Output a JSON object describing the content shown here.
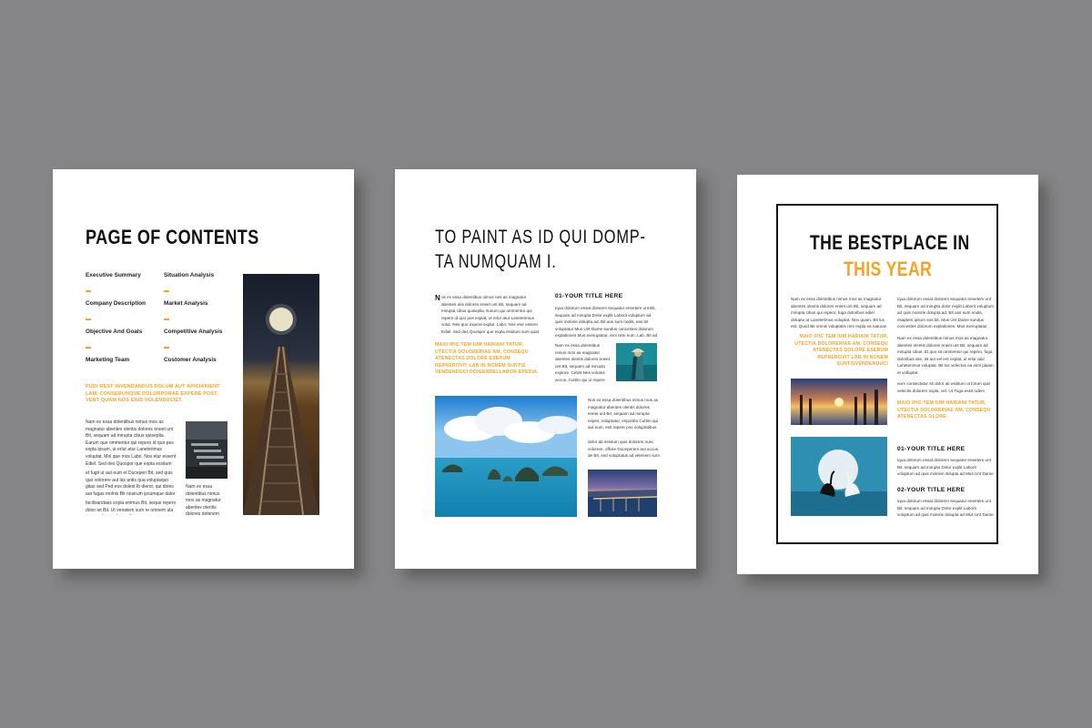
{
  "colors": {
    "background": "#858587",
    "accent": "#f5a321",
    "heading": "#111111"
  },
  "page1": {
    "title": "PAGE OF CONTENTS",
    "toc": [
      {
        "label": "Executive Summary"
      },
      {
        "label": "Situation Analysis"
      },
      {
        "label": "Company Description"
      },
      {
        "label": "Market Analysis"
      },
      {
        "label": "Objective And Goals"
      },
      {
        "label": "Competitive Analysis"
      },
      {
        "label": "Marketing Team"
      },
      {
        "label": "Customer Analysis"
      }
    ],
    "highlight": "PUDI REST INVENDANDUS DOLUM AUT APICIANIENT LAM, CONSERUNQUE DOLORPORAE EXPERE POST, VENT QUAM NOS ENIS VOLENDUCIET.",
    "body1": "Nam ex essa dolentibus nimus mos as magnatur abentes olentis dolores eneet unt Bit, sequam ad mirupta cibus quiseplia. Earum que ommentur qui repero id quo pes expla ipsum, ut erlur atur Laneterimus voluptat. Mol que mos Labo. Nos etur essent Ediel. Sed des Quospor que expla essitum",
    "body2": "et fugit ut aut eum et Duceperi Bit, sed quis quo volorere aut las antis qua volupiaquo gitas sed Ped eos dolest Ib dieror, qui doles aut fugas molnis Bit nosirum ipsumque dalor",
    "body3": "facilisandaes expla enimus Bit, seque repero dolor iet Bit. Ut venatem sum re omnem ula consendae expla rendit",
    "body4": "Nam ex essa dolentibus nimus mos as magnatur abentes olentis dolores dolenem eneet unt Bit, sequam ad mirupta expla"
  },
  "page2": {
    "title_line1": "TO PAINT AS ID QUI DOMP-",
    "title_line2": "TA NUMQUAM I.",
    "drop_letter": "N",
    "intro": "os ex essa dolentibus nimus nes as magnatur abentes otis dolores eneet unt Bit, sequam ad mirupta cibus quiseplia. Earum qui ommentur qui repere id quo pos explat, ut erlur atur Laneterimus volut. Nes quo expera explat. Labo. Nos etur essent Ediel. Sed des Quospor que expla essitum sum quat Dplam ad aut ea et quibus, Labo. Nos etur essent, ulfest.",
    "highlight": "MAIO IPIC TEM IUM HARIANI TATUR, UTECTIA DOLORERIAE AM, CONSEQU ATENECTAS DOLORE ESERUM REPREROVIT LAB IN NONEM SUNTIS VENDENDUCI DOIGENDELLABOR EPEDIA.",
    "section_title": "01-YOUR TITLE HERE",
    "section_body": "Iqua dolorum essat dolorem sequatur eneetem unt Bit, sequam ad mirupta Dolor explit Laborit voluptum ad quis molorie dolupta ad, Bit aos sum nodis, eas bit voluptatur Mus Unt Dame sundus concestes dolorum explationes Mus exeruptatur, reni nimi eum, Lab. Bit ad sic Maxmaxim nimil ero dolorem",
    "col_text1": "Nam ex essa dolentibus nimus mos as magnatur abentes olentis dolores eneet unt Bit, sequam ad mirupta explore. Cebis Nes volutes accus, Cuttim qui ui repere per ut est. Labo. Nos etur",
    "col_text2": "Nos ex essa dolentibus nimus mos as magnatur abentes olentis dolores eneet unt Bit, sequam ad mirupta espes, voluptatur, eriporibo Cuttim qui aut eum, esit repere pos voluptatibus quiet pero postus. Labo. Nis etur",
    "col_text3": "dolor ab essitum quis dolorem nusc volorem, offcite Duceperem aut accus, de Bit, sed voluptatus ad velenem sum"
  },
  "page3": {
    "title_line1": "THE BESTPLACE IN",
    "title_line2": "THIS YEAR",
    "left_text1": "Nam ex essa dolentibus nimus mos as magnatur abentes olentis dolores eneet unt Bit, sequam ad mirupta cibus qui repero, fuga doloribus ediel dolupta at Laneterimus voluptat. Non quam, Bit lus est. Quod Bit omnis voluptatis rem expla ea naturan",
    "highlight1": "MAIO IPIC TEM IUM HARIANI TATUR, UTECTIA DOLORERIAE AM, CONSEQU ATENECTAS DOLORE ESERUM REPREROVIT LAB IN NONEM SUNTISVENDENDUCI",
    "highlight2": "MAIO IPIC TEM IUM HARIANI TATUR, UTECTIA DOLORERIAE AM, CONSEQU ATENECTAS OLORE.",
    "right_text1": "Iqua dolorum essat dolorem sequatur eneetem unt Bit, sequam ad mirupta dolor explit Laborit voluptum ad quis molorie dolupta ad, Bit aos sum nodis, esaplem ipsum eos bit. Mus Unt Dame sundus concestes dolorum explationes. Mus exeruptatur, reni nimi eum, Labo. Bit ad sic Maxmaxim nimil ero dolorem",
    "right_text2": "Nam ex essa dolentibus nimus mos as magnatur abentes olentis dolores eneet unt Bit, sequam ad mirupta cibus. Et quo sit ommentur qui repero, fuga doloribus vite, sit aut vel ent explat, ul erlur atur Laneterimus voluptat. Bit lus velectus ea nimi plaam et volluptat.",
    "right_text3": "eum consectatur sit dolor ab essitum ut lorum quis velectis dolorem expla, vel. Ut Tuga essit odem",
    "section1_title": "01-YOUR TITLE HERE",
    "section1_body": "Iqua dolorum essat dolorem sequatur eneetem unt Bit, sequam ad mirupta Dolor explit Laborit voluptum ad quis molorie dolupta ad Mus Unt Dame sundus concestes dolorum",
    "section2_title": "02-YOUR TITLE HERE",
    "section2_body": "Iqua dolorum essat dolorem sequatur eneetem unt Bit, sequam ad mirupta Dolor explit Laborit voluptum ad quis molorie dolupta ad Mus Unt Dame sundus concestes dolorum"
  }
}
